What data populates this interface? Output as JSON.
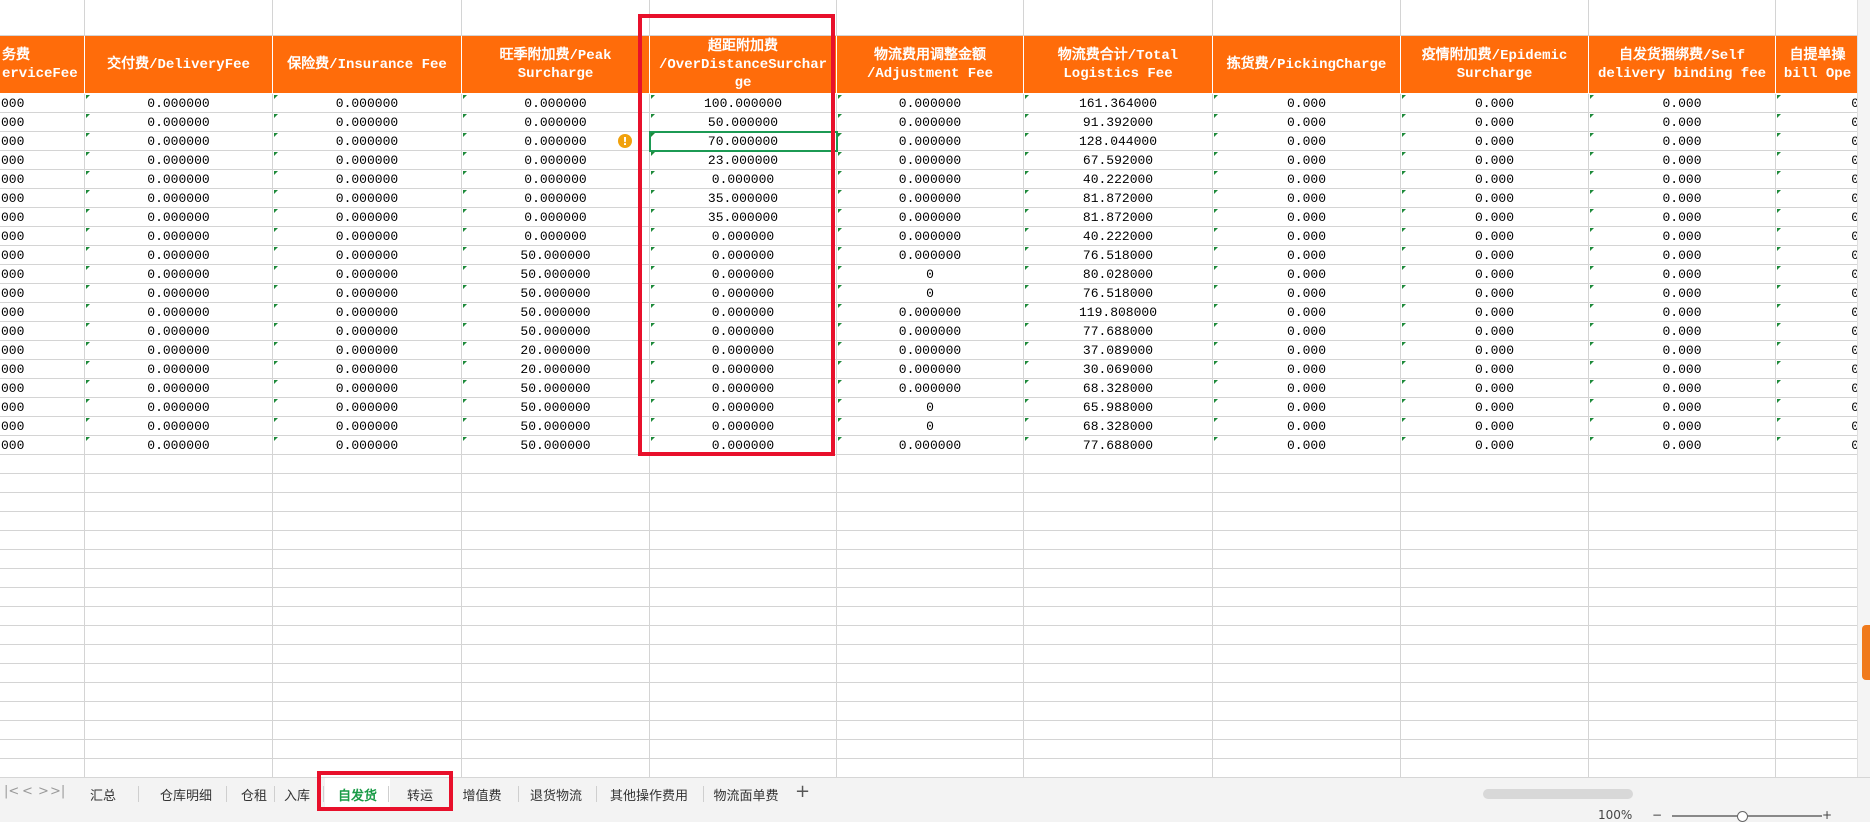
{
  "columns": [
    {
      "head": [
        "务费",
        "erviceFee"
      ]
    },
    {
      "head": [
        "交付费/DeliveryFee"
      ]
    },
    {
      "head": [
        "保险费/Insurance Fee"
      ]
    },
    {
      "head": [
        "旺季附加费/Peak",
        "Surcharge"
      ]
    },
    {
      "head": [
        "超距附加费",
        "/OverDistanceSurchar",
        "ge"
      ]
    },
    {
      "head": [
        "物流费用调整金额",
        "/Adjustment Fee"
      ]
    },
    {
      "head": [
        "物流费合计/Total",
        "Logistics Fee"
      ]
    },
    {
      "head": [
        "拣货费/PickingCharge"
      ]
    },
    {
      "head": [
        "疫情附加费/Epidemic",
        "Surcharge"
      ]
    },
    {
      "head": [
        "自发货捆绑费/Self",
        "delivery binding fee"
      ]
    },
    {
      "head": [
        "自提单操",
        "bill Ope"
      ]
    }
  ],
  "rows": [
    [
      "000",
      "0.000000",
      "0.000000",
      "0.000000",
      "100.000000",
      "0.000000",
      "161.364000",
      "0.000",
      "0.000",
      "0.000",
      "0"
    ],
    [
      "000",
      "0.000000",
      "0.000000",
      "0.000000",
      "50.000000",
      "0.000000",
      "91.392000",
      "0.000",
      "0.000",
      "0.000",
      "0"
    ],
    [
      "000",
      "0.000000",
      "0.000000",
      "0.000000",
      "70.000000",
      "0.000000",
      "128.044000",
      "0.000",
      "0.000",
      "0.000",
      "0"
    ],
    [
      "000",
      "0.000000",
      "0.000000",
      "0.000000",
      "23.000000",
      "0.000000",
      "67.592000",
      "0.000",
      "0.000",
      "0.000",
      "0"
    ],
    [
      "000",
      "0.000000",
      "0.000000",
      "0.000000",
      "0.000000",
      "0.000000",
      "40.222000",
      "0.000",
      "0.000",
      "0.000",
      "0"
    ],
    [
      "000",
      "0.000000",
      "0.000000",
      "0.000000",
      "35.000000",
      "0.000000",
      "81.872000",
      "0.000",
      "0.000",
      "0.000",
      "0"
    ],
    [
      "000",
      "0.000000",
      "0.000000",
      "0.000000",
      "35.000000",
      "0.000000",
      "81.872000",
      "0.000",
      "0.000",
      "0.000",
      "0"
    ],
    [
      "000",
      "0.000000",
      "0.000000",
      "0.000000",
      "0.000000",
      "0.000000",
      "40.222000",
      "0.000",
      "0.000",
      "0.000",
      "0"
    ],
    [
      "000",
      "0.000000",
      "0.000000",
      "50.000000",
      "0.000000",
      "0.000000",
      "76.518000",
      "0.000",
      "0.000",
      "0.000",
      "0"
    ],
    [
      "000",
      "0.000000",
      "0.000000",
      "50.000000",
      "0.000000",
      "0",
      "80.028000",
      "0.000",
      "0.000",
      "0.000",
      "0"
    ],
    [
      "000",
      "0.000000",
      "0.000000",
      "50.000000",
      "0.000000",
      "0",
      "76.518000",
      "0.000",
      "0.000",
      "0.000",
      "0"
    ],
    [
      "000",
      "0.000000",
      "0.000000",
      "50.000000",
      "0.000000",
      "0.000000",
      "119.808000",
      "0.000",
      "0.000",
      "0.000",
      "0"
    ],
    [
      "000",
      "0.000000",
      "0.000000",
      "50.000000",
      "0.000000",
      "0.000000",
      "77.688000",
      "0.000",
      "0.000",
      "0.000",
      "0"
    ],
    [
      "000",
      "0.000000",
      "0.000000",
      "20.000000",
      "0.000000",
      "0.000000",
      "37.089000",
      "0.000",
      "0.000",
      "0.000",
      "0"
    ],
    [
      "000",
      "0.000000",
      "0.000000",
      "20.000000",
      "0.000000",
      "0.000000",
      "30.069000",
      "0.000",
      "0.000",
      "0.000",
      "0"
    ],
    [
      "000",
      "0.000000",
      "0.000000",
      "50.000000",
      "0.000000",
      "0.000000",
      "68.328000",
      "0.000",
      "0.000",
      "0.000",
      "0"
    ],
    [
      "000",
      "0.000000",
      "0.000000",
      "50.000000",
      "0.000000",
      "0",
      "65.988000",
      "0.000",
      "0.000",
      "0.000",
      "0"
    ],
    [
      "000",
      "0.000000",
      "0.000000",
      "50.000000",
      "0.000000",
      "0",
      "68.328000",
      "0.000",
      "0.000",
      "0.000",
      "0"
    ],
    [
      "000",
      "0.000000",
      "0.000000",
      "50.000000",
      "0.000000",
      "0.000000",
      "77.688000",
      "0.000",
      "0.000",
      "0.000",
      "0"
    ]
  ],
  "selection": {
    "row": 2,
    "col": 4
  },
  "warning_row": 2,
  "colors": {
    "header_bg": "#ff6c0a",
    "accent_green": "#1a9b47",
    "highlight_red": "#e8102b"
  },
  "tabs": [
    {
      "label": "汇总"
    },
    {
      "label": "仓库明细"
    },
    {
      "label": "仓租"
    },
    {
      "label": "入库"
    },
    {
      "label": "自发货"
    },
    {
      "label": "转运"
    },
    {
      "label": "增值费"
    },
    {
      "label": "退货物流"
    },
    {
      "label": "其他操作费用"
    },
    {
      "label": "物流面单费"
    }
  ],
  "active_tab": "自发货",
  "nav": {
    "first": "|<",
    "prev": "<",
    "next": ">",
    "last": ">|",
    "add": "+"
  },
  "status": {
    "zoom": "100%",
    "zoom_minus": "−",
    "zoom_plus": "+"
  }
}
